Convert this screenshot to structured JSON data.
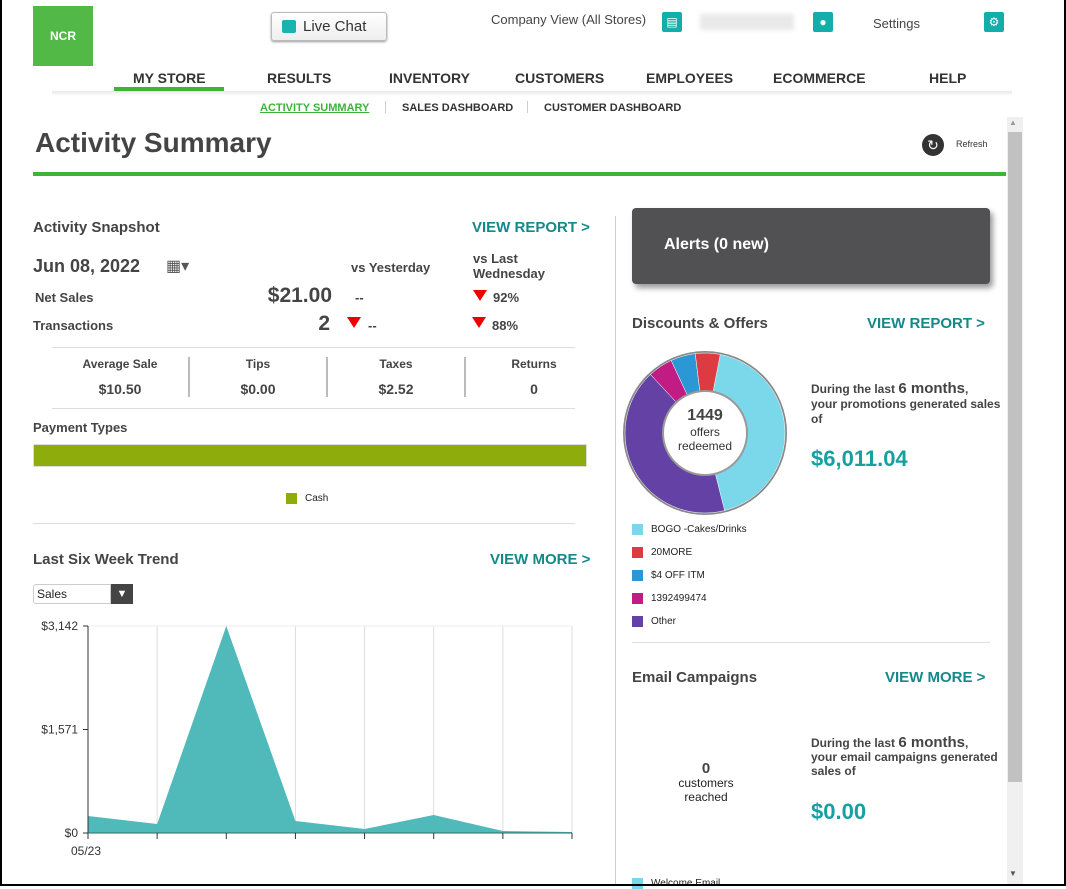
{
  "header": {
    "logo_text": "NCR",
    "live_chat": "Live Chat",
    "company_view": "Company View (All Stores)",
    "settings": "Settings"
  },
  "nav": {
    "items": [
      "MY STORE",
      "RESULTS",
      "INVENTORY",
      "CUSTOMERS",
      "EMPLOYEES",
      "ECOMMERCE",
      "HELP"
    ],
    "active": "MY STORE"
  },
  "subnav": {
    "items": [
      "ACTIVITY SUMMARY",
      "SALES DASHBOARD",
      "CUSTOMER DASHBOARD"
    ],
    "active": "ACTIVITY SUMMARY"
  },
  "page": {
    "title": "Activity Summary",
    "refresh": "Refresh"
  },
  "snapshot": {
    "title": "Activity Snapshot",
    "view_report": "VIEW REPORT >",
    "date": "Jun 08, 2022",
    "vs_yesterday": "vs Yesterday",
    "vs_last": "vs Last Wednesday",
    "net_sales_label": "Net Sales",
    "net_sales": "$21.00",
    "net_sales_vs_yesterday": "--",
    "net_sales_vs_last": "92%",
    "transactions_label": "Transactions",
    "transactions": "2",
    "transactions_vs_yesterday": "--",
    "transactions_vs_last": "88%",
    "stats": [
      {
        "label": "Average Sale",
        "value": "$10.50"
      },
      {
        "label": "Tips",
        "value": "$0.00"
      },
      {
        "label": "Taxes",
        "value": "$2.52"
      },
      {
        "label": "Returns",
        "value": "0"
      }
    ]
  },
  "payment": {
    "title": "Payment Types",
    "legend": "Cash",
    "color": "#8fac0d",
    "share": 1.0
  },
  "trend": {
    "title": "Last Six Week Trend",
    "view_more": "VIEW MORE >",
    "select": "Sales"
  },
  "chart_data": {
    "type": "area",
    "x": [
      "05/23",
      "",
      "",
      "",
      "",
      "",
      "",
      ""
    ],
    "xtick_labels": [
      "05/23"
    ],
    "values": [
      258,
      137,
      3142,
      182,
      61,
      273,
      30,
      15
    ],
    "ylim": [
      0,
      3142
    ],
    "yticks": [
      "$0",
      "$1,571",
      "$3,142"
    ],
    "color": "#47b5b5",
    "grid": "vertical"
  },
  "alerts": {
    "title": "Alerts (0 new)"
  },
  "discounts": {
    "title": "Discounts & Offers",
    "view_report": "VIEW REPORT >",
    "center_value": "1449",
    "center_l1": "offers",
    "center_l2": "redeemed",
    "text_a": "During the last ",
    "text_b": "6 months",
    "text_c": ",",
    "text_d": "your promotions generated sales of",
    "amount": "$6,011.04",
    "slices": [
      {
        "name": "BOGO -Cakes/Drinks",
        "value": 43,
        "color": "#7ad8ea"
      },
      {
        "name": "20MORE",
        "value": 5,
        "color": "#db3b41"
      },
      {
        "name": "$4 OFF ITM",
        "value": 5,
        "color": "#2b97d4"
      },
      {
        "name": "1392499474",
        "value": 5,
        "color": "#c01c84"
      },
      {
        "name": "Other",
        "value": 42,
        "color": "#6441a4"
      }
    ],
    "draw_order": [
      0,
      4,
      3,
      2,
      1
    ]
  },
  "email": {
    "title": "Email Campaigns",
    "view_more": "VIEW MORE >",
    "count": "0",
    "l1": "customers",
    "l2": "reached",
    "text_a": "During the last ",
    "text_b": "6 months",
    "text_c": ",",
    "text_d": "your email campaigns generated sales of",
    "amount": "$0.00",
    "legend_first": "Welcome Email"
  }
}
